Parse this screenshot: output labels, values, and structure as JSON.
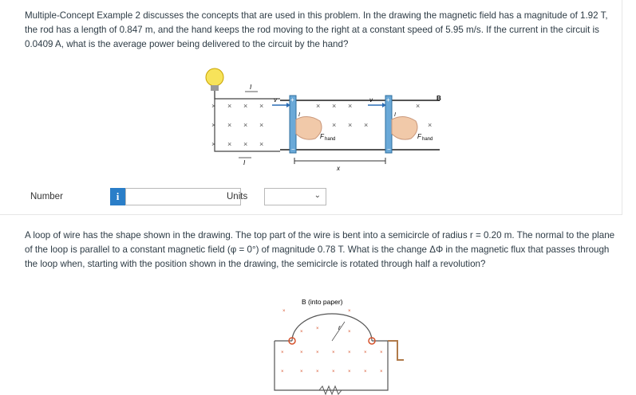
{
  "question1": {
    "text": "Multiple-Concept Example 2 discusses the concepts that are used in this problem. In the drawing the magnetic field has a magnitude of 1.92 T, the rod has a length of 0.847 m, and the hand keeps the rod moving to the right at a constant speed of 5.95 m/s. If the current in the circuit is 0.0409 A, what is the average power being delivered to the circuit by the hand?",
    "figure": {
      "label_I_top": "I",
      "label_I_bottom": "I",
      "label_B": "B",
      "label_v_left": "v",
      "label_v_right": "v",
      "label_F_left": "F",
      "label_F_right": "F",
      "label_hand_left": "hand",
      "label_hand_right": "hand",
      "label_I_rod_left": "I",
      "label_I_rod_right": "I",
      "label_x_dist": "x",
      "label_plus": "+",
      "label_minus": "−"
    }
  },
  "answer": {
    "number_label": "Number",
    "info_icon": "i",
    "number_value": "",
    "units_label": "Units",
    "units_value": ""
  },
  "question2": {
    "text": "A loop of wire has the shape shown in the drawing. The top part of the wire is bent into a semicircle of radius r = 0.20 m. The normal to the plane of the loop is parallel to a constant magnetic field (φ = 0°) of magnitude 0.78 T. What is the change ΔΦ in the magnetic flux that passes through the loop when, starting with the position shown in the drawing, the semicircle is rotated through half a revolution?",
    "figure": {
      "b_label": "B (into paper)",
      "r_label": "r"
    }
  }
}
